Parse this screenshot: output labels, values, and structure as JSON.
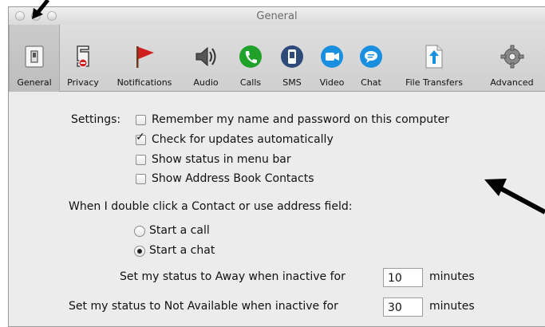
{
  "window": {
    "title": "General"
  },
  "toolbar": {
    "items": [
      {
        "label": "General",
        "icon": "general-switch-icon",
        "selected": true
      },
      {
        "label": "Privacy",
        "icon": "privacy-lock-icon"
      },
      {
        "label": "Notifications",
        "icon": "notifications-flag-icon"
      },
      {
        "label": "Audio",
        "icon": "audio-speaker-icon"
      },
      {
        "label": "Calls",
        "icon": "calls-phone-icon",
        "color": "#1fa12a"
      },
      {
        "label": "SMS",
        "icon": "sms-icon",
        "color": "#2d4a78"
      },
      {
        "label": "Video",
        "icon": "video-camera-icon",
        "color": "#1a8fe0"
      },
      {
        "label": "Chat",
        "icon": "chat-bubble-icon",
        "color": "#1a8fe0"
      },
      {
        "label": "File Transfers",
        "icon": "file-transfer-icon"
      },
      {
        "label": "Advanced",
        "icon": "advanced-gear-icon"
      }
    ]
  },
  "settings": {
    "label": "Settings:",
    "checkboxes": [
      {
        "label": "Remember my name and password on this computer",
        "checked": false
      },
      {
        "label": "Check for updates automatically",
        "checked": true
      },
      {
        "label": "Show status in menu bar",
        "checked": false
      },
      {
        "label": "Show Address Book Contacts",
        "checked": false
      }
    ]
  },
  "double_click": {
    "label": "When I double click a Contact or use address field:",
    "options": [
      {
        "label": "Start a call",
        "selected": false
      },
      {
        "label": "Start a chat",
        "selected": true
      }
    ]
  },
  "away": {
    "label": "Set my status to Away when inactive for",
    "value": "10",
    "unit": "minutes"
  },
  "not_available": {
    "label": "Set my status to Not Available when inactive for",
    "value": "30",
    "unit": "minutes"
  }
}
